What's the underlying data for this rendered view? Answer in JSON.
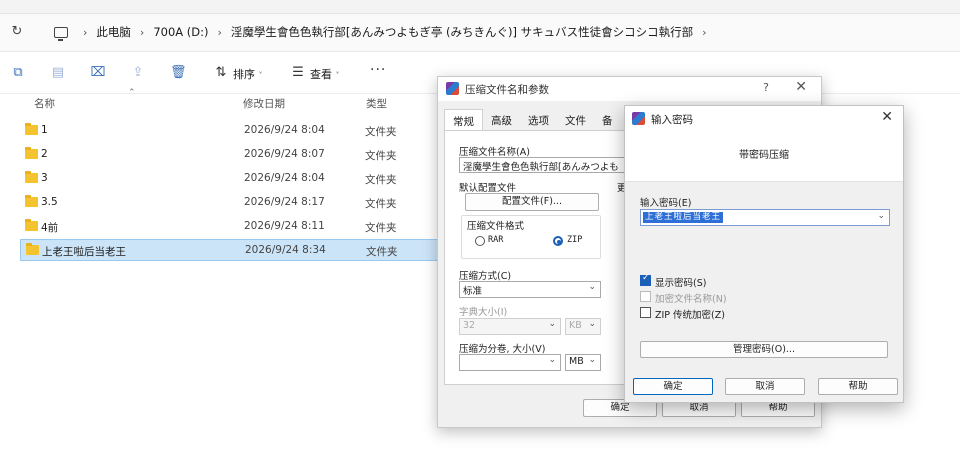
{
  "explorer": {
    "address": {
      "crumbs": [
        "此电脑",
        "700A (D:)",
        "淫魔學生會色色執行部[あんみつよもぎ亭 (みちきんぐ)] サキュバス性徒會シコシコ執行部"
      ]
    },
    "toolbar": {
      "sort_label": "排序",
      "view_label": "查看",
      "more_label": "···"
    },
    "columns": {
      "name": "名称",
      "date": "修改日期",
      "type": "类型"
    },
    "files": [
      {
        "name": "1",
        "date": "2026/9/24 8:04",
        "type": "文件夹",
        "selected": false
      },
      {
        "name": "2",
        "date": "2026/9/24 8:07",
        "type": "文件夹",
        "selected": false
      },
      {
        "name": "3",
        "date": "2026/9/24 8:04",
        "type": "文件夹",
        "selected": false
      },
      {
        "name": "3.5",
        "date": "2026/9/24 8:17",
        "type": "文件夹",
        "selected": false
      },
      {
        "name": "4前",
        "date": "2026/9/24 8:11",
        "type": "文件夹",
        "selected": false
      },
      {
        "name": "上老王啦后当老王",
        "date": "2026/9/24 8:34",
        "type": "文件夹",
        "selected": true
      }
    ]
  },
  "zip_dialog": {
    "title": "压缩文件名和参数",
    "help": "?",
    "tabs": [
      "常规",
      "高级",
      "选项",
      "文件",
      "备"
    ],
    "archive_name_label": "压缩文件名称(A)",
    "archive_name_value": "淫魔學生會色色執行部[あんみつよも",
    "profile_label": "默认配置文件",
    "profile_button": "配置文件(F)...",
    "update_label": "更",
    "format_group": "压缩文件格式",
    "format_rar": "RAR",
    "format_zip": "ZIP",
    "method_label": "压缩方式(C)",
    "method_value": "标准",
    "dict_label": "字典大小(I)",
    "dict_value": "32",
    "dict_unit": "KB",
    "split_label": "压缩为分卷, 大小(V)",
    "split_value": "",
    "split_unit": "MB",
    "ok": "确定",
    "cancel": "取消",
    "help_btn": "帮助"
  },
  "password_dialog": {
    "title": "输入密码",
    "heading": "带密码压缩",
    "password_label": "输入密码(E)",
    "password_value": "上老王啦后当老王",
    "show_password": "显示密码(S)",
    "encrypt_names": "加密文件名称(N)",
    "zip_legacy": "ZIP 传统加密(Z)",
    "manage_button": "管理密码(O)...",
    "ok": "确定",
    "cancel": "取消",
    "help": "帮助"
  }
}
